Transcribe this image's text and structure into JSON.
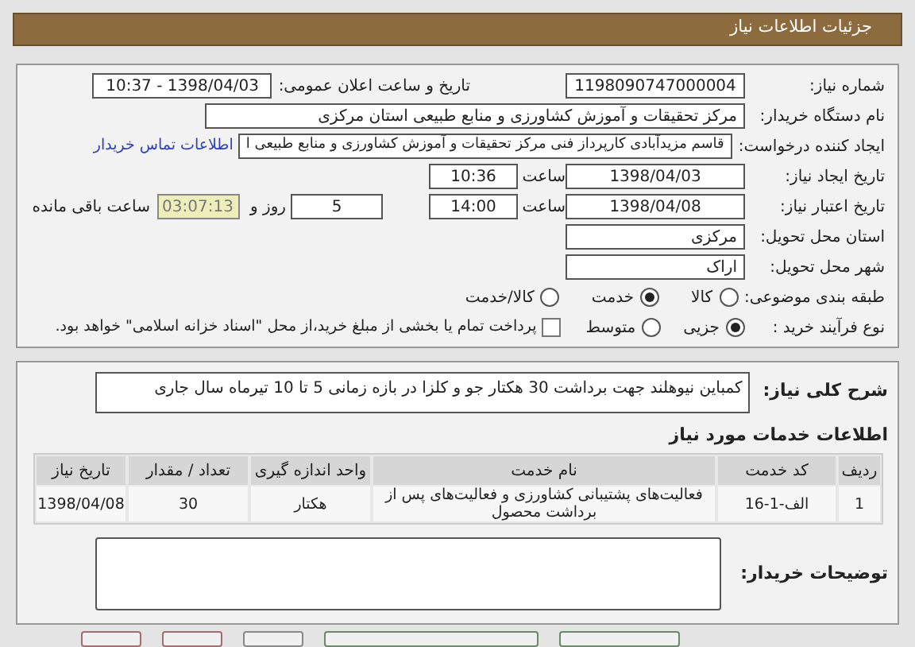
{
  "header": {
    "title": "جزئیات اطلاعات نیاز"
  },
  "details": {
    "need_number": {
      "label": "شماره نیاز:",
      "value": "1198090747000004"
    },
    "announce": {
      "label": "تاریخ و ساعت اعلان عمومی:",
      "value": "1398/04/03 - 10:37"
    },
    "buyer": {
      "label": "نام دستگاه خریدار:",
      "value": "مرکز تحقیقات و آموزش کشاورزی و منابع طبیعی استان مرکزی"
    },
    "requester": {
      "label": "ایجاد کننده درخواست:",
      "value": "قاسم مزیدآبادی کارپرداز فنی مرکز تحقیقات و آموزش کشاورزی و منابع طبیعی ا",
      "link": "اطلاعات تماس خریدار"
    },
    "created": {
      "label": "تاریخ ایجاد نیاز:",
      "date": "1398/04/03",
      "time_label": "ساعت",
      "time": "10:36"
    },
    "validity": {
      "label": "تاریخ اعتبار نیاز:",
      "date": "1398/04/08",
      "time_label": "ساعت",
      "time": "14:00",
      "days": "5",
      "days_label": "روز و",
      "remaining": "03:07:13",
      "remaining_label": "ساعت باقی مانده"
    },
    "province": {
      "label": "استان محل تحویل:",
      "value": "مرکزی"
    },
    "city": {
      "label": "شهر محل تحویل:",
      "value": "اراک"
    },
    "category": {
      "label": "طبقه بندی موضوعی:",
      "options": [
        {
          "label": "کالا",
          "selected": false
        },
        {
          "label": "خدمت",
          "selected": true
        },
        {
          "label": "کالا/خدمت",
          "selected": false
        }
      ]
    },
    "process": {
      "label": "نوع فرآیند خرید :",
      "options": [
        {
          "label": "جزیی",
          "selected": true
        },
        {
          "label": "متوسط",
          "selected": false
        }
      ],
      "payment": {
        "label": "پرداخت تمام یا بخشی از مبلغ خرید،از محل \"اسناد خزانه اسلامی\" خواهد بود.",
        "checked": false
      }
    }
  },
  "description": {
    "label": "شرح کلی نیاز:",
    "value": "کمباین نیوهلند جهت برداشت 30 هکتار جو و کلزا در بازه زمانی 5 تا 10 تیرماه سال جاری"
  },
  "services": {
    "title": "اطلاعات خدمات مورد نیاز",
    "columns": [
      "ردیف",
      "کد خدمت",
      "نام خدمت",
      "واحد اندازه گیری",
      "تعداد / مقدار",
      "تاریخ نیاز"
    ],
    "rows": [
      [
        "1",
        "الف-1-16",
        "فعالیت‌های پشتیبانی کشاورزی و فعالیت‌های پس از برداشت محصول",
        "هکتار",
        "30",
        "1398/04/08"
      ]
    ]
  },
  "buyer_notes": {
    "label": "توضیحات خریدار:"
  }
}
